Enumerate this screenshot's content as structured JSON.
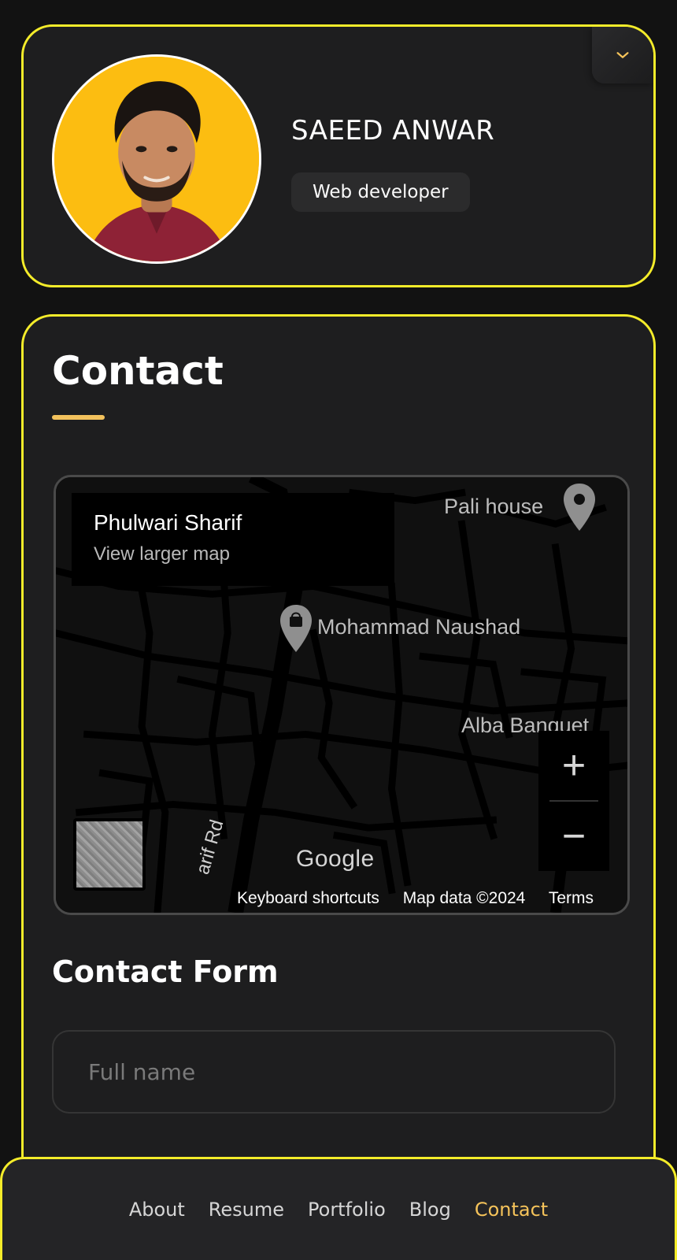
{
  "profile": {
    "name": "SAEED ANWAR",
    "role": "Web developer"
  },
  "contact": {
    "title": "Contact",
    "map": {
      "place_name": "Phulwari Sharif",
      "larger_map_link": "View larger map",
      "labels": {
        "pali_house": "Pali house",
        "mohammad_naushad": "Mohammad Naushad",
        "alba_banquet": "Alba Banquet",
        "road": "arif Rd"
      },
      "zoom_in": "+",
      "zoom_out": "−",
      "google": "Google",
      "footer": {
        "shortcuts": "Keyboard shortcuts",
        "data": "Map data ©2024",
        "terms": "Terms"
      }
    },
    "form": {
      "title": "Contact Form",
      "fullname_placeholder": "Full name"
    }
  },
  "nav": {
    "items": [
      {
        "label": "About"
      },
      {
        "label": "Resume"
      },
      {
        "label": "Portfolio"
      },
      {
        "label": "Blog"
      },
      {
        "label": "Contact"
      }
    ],
    "active": "Contact"
  },
  "colors": {
    "accent_border": "#f4ec2a",
    "accent_gold": "#f5c35a",
    "background": "#121212",
    "card": "#1e1e1f"
  }
}
